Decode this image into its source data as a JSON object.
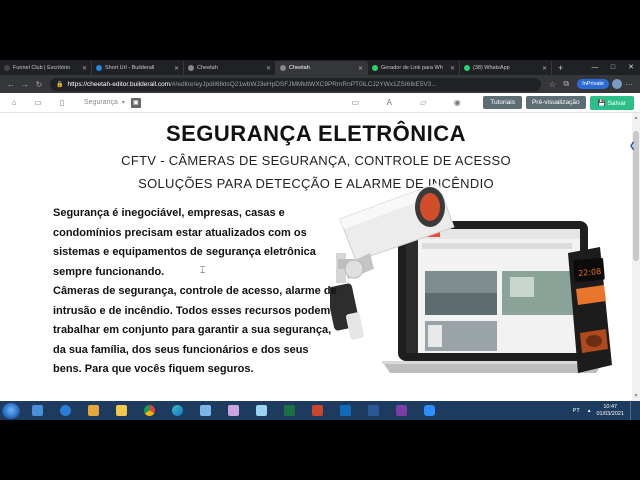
{
  "browser": {
    "tabs": [
      {
        "label": "Funnel Club | Escritório",
        "favicon_color": "#444444",
        "active": false
      },
      {
        "label": "Short Url - Builderall",
        "favicon_color": "#1e88e5",
        "active": false
      },
      {
        "label": "Cheetah",
        "favicon_color": "#888888",
        "active": false
      },
      {
        "label": "Cheetah",
        "favicon_color": "#888888",
        "active": true
      },
      {
        "label": "Gerador de Link para Wh",
        "favicon_color": "#25d366",
        "active": false
      },
      {
        "label": "(38) WhatsApp",
        "favicon_color": "#25d366",
        "active": false
      }
    ],
    "url_host": "https://cheetah-editor.builderall.com",
    "url_rest": "/#/editor/eyJpdiI6IktsQ21wbWJ3eHpDSFJMMkttWXC9PRmRnPT0iLCJ2YWx1ZSI6IkE5V3...",
    "inprivate_label": "InPrivate"
  },
  "editor": {
    "page_select": "Segurança",
    "tutorials_label": "Tutoriais",
    "preview_label": "Pré-visualização",
    "save_label": "Salvar"
  },
  "content": {
    "title": "SEGURANÇA ELETRÔNICA",
    "subtitle1": "CFTV - CÂMERAS DE SEGURANÇA, CONTROLE DE ACESSO",
    "subtitle2": "SOLUÇÕES PARA DETECÇÃO E ALARME DE INCÊNDIO",
    "paragraphs": [
      "Segurança é inegociável, empresas, casas e condomínios precisam estar atualizados com os sistemas e equipamentos de segurança eletrônica sempre funcionando.",
      "Câmeras de segurança, controle de acesso, alarme de intrusão e de incêndio. Todos esses recursos podem trabalhar em conjunto para garantir a sua segurança, da sua família, dos seus funcionários e dos seus bens. Para que vocês fiquem seguros."
    ],
    "device_time": "22:08"
  },
  "taskbar": {
    "apps": [
      "explorer-icon",
      "ie-icon",
      "media-icon",
      "folder-icon",
      "chrome-icon",
      "edge-icon",
      "app-icon",
      "paint-icon",
      "app2-icon",
      "excel-icon",
      "powerpoint-icon",
      "outlook-icon",
      "word-icon",
      "onenote-icon",
      "zoom-icon"
    ],
    "lang": "PT",
    "time": "10:47",
    "date": "01/03/2021"
  }
}
